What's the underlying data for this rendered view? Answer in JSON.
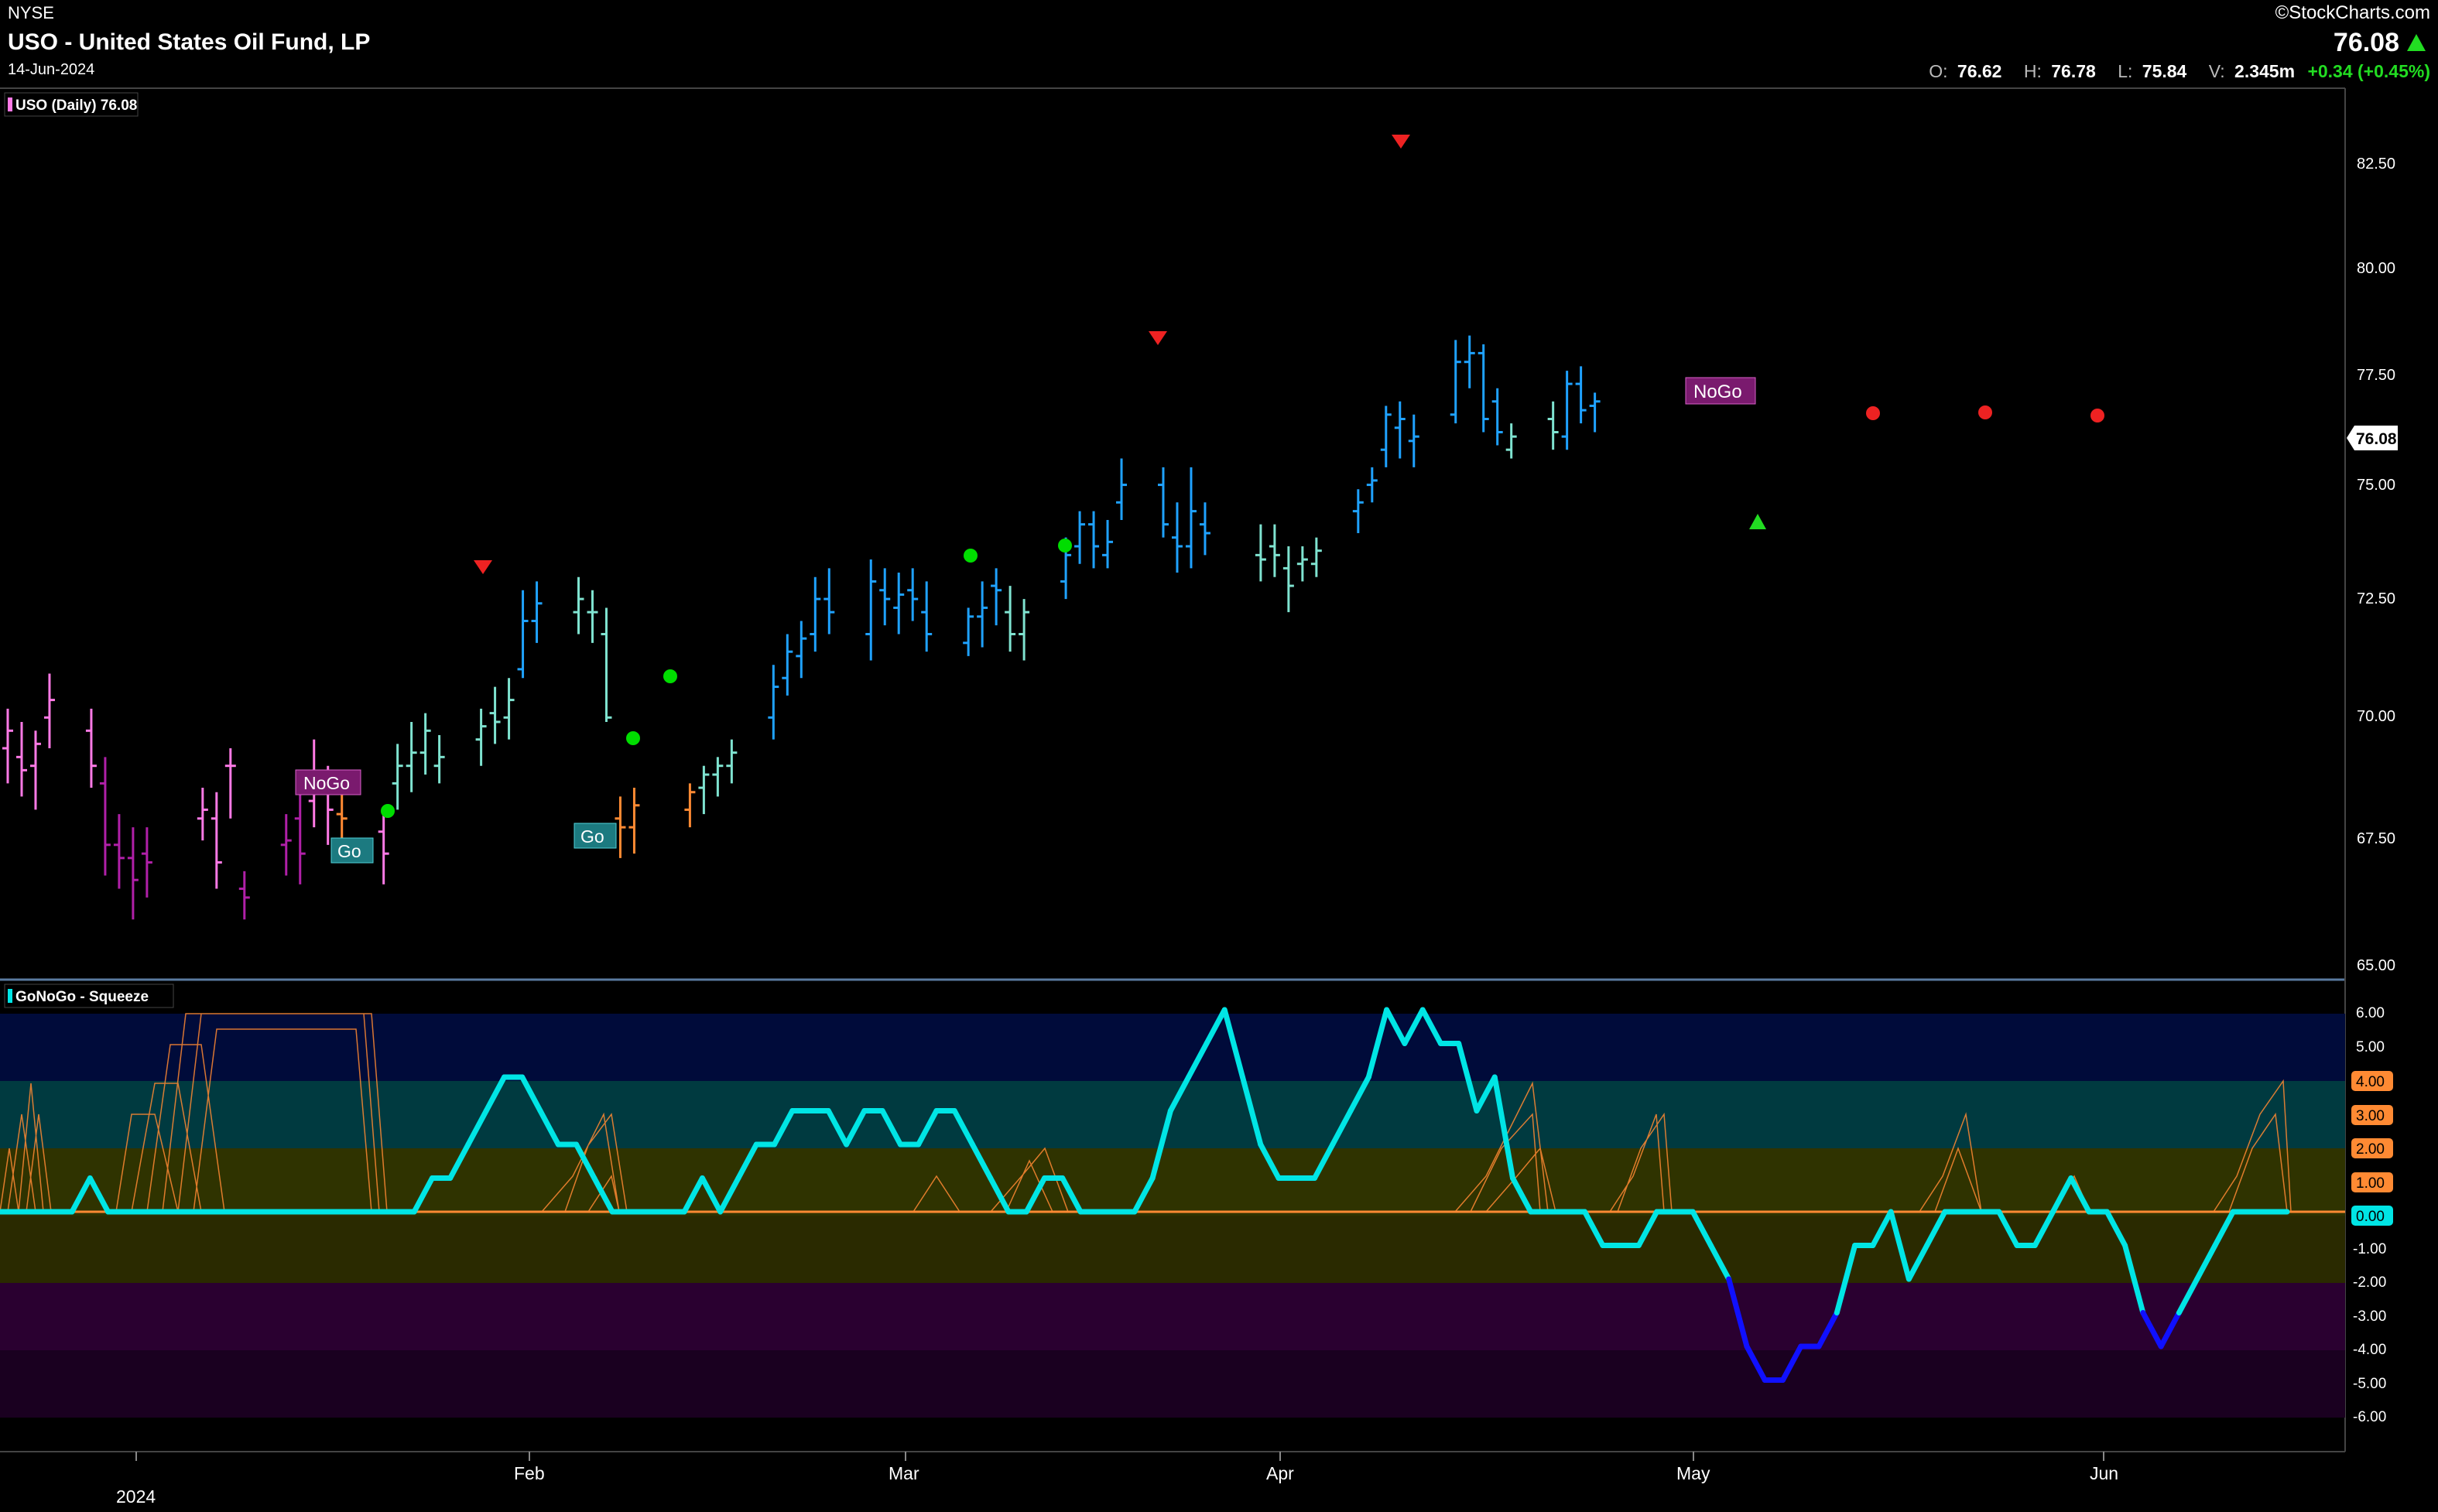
{
  "header": {
    "exchange": "NYSE",
    "title": "USO - United States Oil Fund, LP",
    "date": "14-Jun-2024",
    "brand": "©StockCharts.com",
    "last_price": "76.08",
    "ohlc": {
      "o_label": "O:",
      "o_value": "76.62",
      "h_label": "H:",
      "h_value": "76.78",
      "l_label": "L:",
      "l_value": "75.84",
      "v_label": "V:",
      "v_value": "2.345m",
      "change": "+0.34 (+0.45%)"
    }
  },
  "price_panel": {
    "legend": "USO (Daily) 76.08",
    "last_price_tag": "76.08",
    "y_ticks": [
      "82.50",
      "80.00",
      "77.50",
      "75.00",
      "72.50",
      "70.00",
      "67.50",
      "65.00"
    ],
    "labels": [
      {
        "text": "NoGo",
        "kind": "nogo"
      },
      {
        "text": "Go",
        "kind": "go"
      },
      {
        "text": "Go",
        "kind": "go"
      },
      {
        "text": "NoGo",
        "kind": "nogo"
      }
    ]
  },
  "oscillator_panel": {
    "legend": "GoNoGo - Squeeze",
    "y_ticks": [
      "6.00",
      "5.00",
      "4.00",
      "3.00",
      "2.00",
      "1.00",
      "0.00",
      "-1.00",
      "-2.00",
      "-3.00",
      "-4.00",
      "-5.00",
      "-6.00"
    ],
    "highlighted_ticks": [
      "4.00",
      "3.00",
      "2.00",
      "1.00",
      "0.00"
    ]
  },
  "x_axis": {
    "labels": [
      "2024",
      "Feb",
      "Mar",
      "Apr",
      "May",
      "Jun"
    ]
  },
  "colors": {
    "strong_go": "#1fa2ff",
    "weak_go": "#7fe3d0",
    "weak_nogo": "#ff7ae6",
    "strong_nogo": "#b020a8",
    "neutral": "#ff8a33",
    "oscillator": "#00e5e5",
    "oscillator_low": "#1010ff",
    "squeeze": "#ff8a33"
  },
  "chart_data": [
    {
      "type": "ohlc",
      "title": "USO (Daily) 76.08",
      "ylim": [
        64.5,
        83.8
      ],
      "x_range": [
        "2024-01-02",
        "2024-06-14"
      ],
      "last": {
        "open": 76.62,
        "high": 76.78,
        "low": 75.84,
        "close": 76.08,
        "volume": "2.345m",
        "change": 0.34,
        "change_pct": 0.45
      },
      "bars": [
        {
          "date": "2024-01-02",
          "open": 69.4,
          "high": 70.3,
          "low": 68.6,
          "close": 69.8,
          "color": "weak_nogo"
        },
        {
          "date": "2024-01-03",
          "open": 69.2,
          "high": 70.0,
          "low": 68.3,
          "close": 68.9,
          "color": "weak_nogo"
        },
        {
          "date": "2024-01-04",
          "open": 69.0,
          "high": 69.8,
          "low": 68.0,
          "close": 69.5,
          "color": "weak_nogo"
        },
        {
          "date": "2024-01-05",
          "open": 70.1,
          "high": 71.1,
          "low": 69.4,
          "close": 70.5,
          "color": "weak_nogo"
        },
        {
          "date": "2024-01-08",
          "open": 69.8,
          "high": 70.3,
          "low": 68.5,
          "close": 69.0,
          "color": "weak_nogo"
        },
        {
          "date": "2024-01-09",
          "open": 68.6,
          "high": 69.2,
          "low": 66.5,
          "close": 67.2,
          "color": "strong_nogo"
        },
        {
          "date": "2024-01-10",
          "open": 67.2,
          "high": 67.9,
          "low": 66.2,
          "close": 66.9,
          "color": "strong_nogo"
        },
        {
          "date": "2024-01-11",
          "open": 66.9,
          "high": 67.6,
          "low": 65.5,
          "close": 66.4,
          "color": "strong_nogo"
        },
        {
          "date": "2024-01-12",
          "open": 67.0,
          "high": 67.6,
          "low": 66.0,
          "close": 66.8,
          "color": "strong_nogo"
        },
        {
          "date": "2024-01-16",
          "open": 67.8,
          "high": 68.5,
          "low": 67.3,
          "close": 68.0,
          "color": "weak_nogo"
        },
        {
          "date": "2024-01-17",
          "open": 67.8,
          "high": 68.4,
          "low": 66.2,
          "close": 66.8,
          "color": "weak_nogo"
        },
        {
          "date": "2024-01-18",
          "open": 69.0,
          "high": 69.4,
          "low": 67.8,
          "close": 69.0,
          "color": "weak_nogo"
        },
        {
          "date": "2024-01-19",
          "open": 66.2,
          "high": 66.6,
          "low": 65.5,
          "close": 66.0,
          "color": "strong_nogo"
        },
        {
          "date": "2024-01-22",
          "open": 67.2,
          "high": 67.9,
          "low": 66.5,
          "close": 67.3,
          "color": "strong_nogo"
        },
        {
          "date": "2024-01-23",
          "open": 67.8,
          "high": 68.4,
          "low": 66.3,
          "close": 67.0,
          "color": "strong_nogo"
        },
        {
          "date": "2024-01-24",
          "open": 68.2,
          "high": 69.6,
          "low": 67.6,
          "close": 68.7,
          "color": "weak_nogo"
        },
        {
          "date": "2024-01-25",
          "open": 68.5,
          "high": 69.0,
          "low": 67.2,
          "close": 68.0,
          "color": "weak_nogo"
        },
        {
          "date": "2024-01-26",
          "open": 67.9,
          "high": 68.4,
          "low": 67.0,
          "close": 67.8,
          "color": "neutral"
        },
        {
          "date": "2024-01-29",
          "open": 67.5,
          "high": 68.0,
          "low": 66.3,
          "close": 67.0,
          "color": "weak_nogo"
        },
        {
          "date": "2024-01-30",
          "open": 68.6,
          "high": 69.5,
          "low": 68.0,
          "close": 69.0,
          "color": "weak_go"
        },
        {
          "date": "2024-01-31",
          "open": 69.0,
          "high": 70.0,
          "low": 68.4,
          "close": 69.3,
          "color": "weak_go"
        },
        {
          "date": "2024-02-01",
          "open": 69.3,
          "high": 70.2,
          "low": 68.8,
          "close": 69.8,
          "color": "weak_go"
        },
        {
          "date": "2024-02-02",
          "open": 69.0,
          "high": 69.7,
          "low": 68.6,
          "close": 69.2,
          "color": "weak_go"
        },
        {
          "date": "2024-02-05",
          "open": 69.6,
          "high": 70.3,
          "low": 69.0,
          "close": 69.9,
          "color": "weak_go"
        },
        {
          "date": "2024-02-06",
          "open": 70.2,
          "high": 70.8,
          "low": 69.5,
          "close": 70.0,
          "color": "weak_go"
        },
        {
          "date": "2024-02-07",
          "open": 70.1,
          "high": 71.0,
          "low": 69.6,
          "close": 70.5,
          "color": "weak_go"
        },
        {
          "date": "2024-02-08",
          "open": 71.2,
          "high": 73.0,
          "low": 71.0,
          "close": 72.3,
          "color": "strong_go"
        },
        {
          "date": "2024-02-09",
          "open": 72.3,
          "high": 73.2,
          "low": 71.8,
          "close": 72.7,
          "color": "strong_go"
        },
        {
          "date": "2024-02-12",
          "open": 72.5,
          "high": 73.3,
          "low": 72.0,
          "close": 72.8,
          "color": "weak_go"
        },
        {
          "date": "2024-02-13",
          "open": 72.5,
          "high": 73.0,
          "low": 71.8,
          "close": 72.5,
          "color": "weak_go"
        },
        {
          "date": "2024-02-14",
          "open": 72.0,
          "high": 72.6,
          "low": 70.0,
          "close": 70.1,
          "color": "weak_go"
        },
        {
          "date": "2024-02-15",
          "open": 67.8,
          "high": 68.3,
          "low": 66.9,
          "close": 67.6,
          "color": "neutral"
        },
        {
          "date": "2024-02-16",
          "open": 67.6,
          "high": 68.5,
          "low": 67.0,
          "close": 68.1,
          "color": "neutral"
        },
        {
          "date": "2024-02-20",
          "open": 68.0,
          "high": 68.6,
          "low": 67.6,
          "close": 68.4,
          "color": "neutral"
        },
        {
          "date": "2024-02-21",
          "open": 68.5,
          "high": 69.0,
          "low": 67.9,
          "close": 68.8,
          "color": "weak_go"
        },
        {
          "date": "2024-02-22",
          "open": 68.8,
          "high": 69.2,
          "low": 68.3,
          "close": 69.0,
          "color": "weak_go"
        },
        {
          "date": "2024-02-23",
          "open": 69.0,
          "high": 69.6,
          "low": 68.6,
          "close": 69.3,
          "color": "weak_go"
        },
        {
          "date": "2024-02-26",
          "open": 70.1,
          "high": 71.3,
          "low": 69.6,
          "close": 70.8,
          "color": "strong_go"
        },
        {
          "date": "2024-02-27",
          "open": 71.0,
          "high": 72.0,
          "low": 70.6,
          "close": 71.6,
          "color": "strong_go"
        },
        {
          "date": "2024-02-28",
          "open": 71.5,
          "high": 72.3,
          "low": 71.0,
          "close": 71.9,
          "color": "strong_go"
        },
        {
          "date": "2024-02-29",
          "open": 72.0,
          "high": 73.3,
          "low": 71.6,
          "close": 72.8,
          "color": "strong_go"
        },
        {
          "date": "2024-03-01",
          "open": 72.8,
          "high": 73.5,
          "low": 72.0,
          "close": 72.5,
          "color": "strong_go"
        },
        {
          "date": "2024-03-04",
          "open": 72.0,
          "high": 73.7,
          "low": 71.4,
          "close": 73.2,
          "color": "strong_go"
        },
        {
          "date": "2024-03-05",
          "open": 73.0,
          "high": 73.5,
          "low": 72.2,
          "close": 72.8,
          "color": "strong_go"
        },
        {
          "date": "2024-03-06",
          "open": 72.6,
          "high": 73.4,
          "low": 72.0,
          "close": 72.9,
          "color": "strong_go"
        },
        {
          "date": "2024-03-07",
          "open": 73.0,
          "high": 73.5,
          "low": 72.3,
          "close": 72.8,
          "color": "strong_go"
        },
        {
          "date": "2024-03-08",
          "open": 72.5,
          "high": 73.2,
          "low": 71.6,
          "close": 72.0,
          "color": "strong_go"
        },
        {
          "date": "2024-03-11",
          "open": 71.8,
          "high": 72.6,
          "low": 71.5,
          "close": 72.4,
          "color": "strong_go"
        },
        {
          "date": "2024-03-12",
          "open": 72.4,
          "high": 73.2,
          "low": 71.7,
          "close": 72.6,
          "color": "strong_go"
        },
        {
          "date": "2024-03-13",
          "open": 73.1,
          "high": 73.5,
          "low": 72.2,
          "close": 73.0,
          "color": "strong_go"
        },
        {
          "date": "2024-03-14",
          "open": 72.5,
          "high": 73.1,
          "low": 71.6,
          "close": 72.0,
          "color": "weak_go"
        },
        {
          "date": "2024-03-15",
          "open": 72.0,
          "high": 72.8,
          "low": 71.4,
          "close": 72.5,
          "color": "weak_go"
        },
        {
          "date": "2024-03-18",
          "open": 73.2,
          "high": 74.2,
          "low": 72.8,
          "close": 73.8,
          "color": "strong_go"
        },
        {
          "date": "2024-03-19",
          "open": 74.0,
          "high": 74.8,
          "low": 73.6,
          "close": 74.5,
          "color": "strong_go"
        },
        {
          "date": "2024-03-20",
          "open": 74.5,
          "high": 74.8,
          "low": 73.5,
          "close": 74.0,
          "color": "strong_go"
        },
        {
          "date": "2024-03-21",
          "open": 73.8,
          "high": 74.6,
          "low": 73.5,
          "close": 74.1,
          "color": "strong_go"
        },
        {
          "date": "2024-03-22",
          "open": 75.0,
          "high": 76.0,
          "low": 74.6,
          "close": 75.4,
          "color": "strong_go"
        },
        {
          "date": "2024-03-25",
          "open": 75.4,
          "high": 75.8,
          "low": 74.2,
          "close": 74.5,
          "color": "strong_go"
        },
        {
          "date": "2024-03-26",
          "open": 74.2,
          "high": 75.0,
          "low": 73.4,
          "close": 74.0,
          "color": "strong_go"
        },
        {
          "date": "2024-03-27",
          "open": 74.0,
          "high": 75.8,
          "low": 73.5,
          "close": 74.8,
          "color": "strong_go"
        },
        {
          "date": "2024-03-28",
          "open": 74.5,
          "high": 75.0,
          "low": 73.8,
          "close": 74.3,
          "color": "strong_go"
        },
        {
          "date": "2024-04-01",
          "open": 73.8,
          "high": 74.5,
          "low": 73.2,
          "close": 73.7,
          "color": "weak_go"
        },
        {
          "date": "2024-04-02",
          "open": 74.0,
          "high": 74.5,
          "low": 73.3,
          "close": 73.8,
          "color": "weak_go"
        },
        {
          "date": "2024-04-03",
          "open": 73.5,
          "high": 74.0,
          "low": 72.5,
          "close": 73.1,
          "color": "weak_go"
        },
        {
          "date": "2024-04-04",
          "open": 73.6,
          "high": 74.0,
          "low": 73.2,
          "close": 73.7,
          "color": "weak_go"
        },
        {
          "date": "2024-04-05",
          "open": 73.6,
          "high": 74.2,
          "low": 73.3,
          "close": 73.9,
          "color": "weak_go"
        },
        {
          "date": "2024-04-08",
          "open": 74.8,
          "high": 75.3,
          "low": 74.3,
          "close": 75.0,
          "color": "strong_go"
        },
        {
          "date": "2024-04-09",
          "open": 75.4,
          "high": 75.8,
          "low": 75.0,
          "close": 75.5,
          "color": "strong_go"
        },
        {
          "date": "2024-04-10",
          "open": 76.2,
          "high": 77.2,
          "low": 75.8,
          "close": 77.0,
          "color": "strong_go"
        },
        {
          "date": "2024-04-11",
          "open": 76.7,
          "high": 77.3,
          "low": 76.0,
          "close": 76.9,
          "color": "strong_go"
        },
        {
          "date": "2024-04-12",
          "open": 76.4,
          "high": 77.0,
          "low": 75.8,
          "close": 76.5,
          "color": "strong_go"
        },
        {
          "date": "2024-04-15",
          "open": 77.0,
          "high": 78.7,
          "low": 76.8,
          "close": 78.2,
          "color": "strong_go"
        },
        {
          "date": "2024-04-16",
          "open": 78.2,
          "high": 78.8,
          "low": 77.6,
          "close": 78.4,
          "color": "strong_go"
        },
        {
          "date": "2024-04-17",
          "open": 78.4,
          "high": 78.6,
          "low": 76.6,
          "close": 76.9,
          "color": "strong_go"
        },
        {
          "date": "2024-04-18",
          "open": 77.3,
          "high": 77.6,
          "low": 76.3,
          "close": 76.6,
          "color": "strong_go"
        },
        {
          "date": "2024-04-19",
          "open": 76.2,
          "high": 76.8,
          "low": 76.0,
          "close": 76.5,
          "color": "weak_go"
        },
        {
          "date": "2024-04-22",
          "open": 76.9,
          "high": 77.3,
          "low": 76.2,
          "close": 76.6,
          "color": "weak_go"
        },
        {
          "date": "2024-04-23",
          "open": 76.5,
          "high": 78.0,
          "low": 76.2,
          "close": 77.7,
          "color": "strong_go"
        },
        {
          "date": "2024-04-24",
          "open": 77.7,
          "high": 78.1,
          "low": 76.8,
          "close": 77.1,
          "color": "strong_go"
        },
        {
          "date": "2024-04-25",
          "open": 77.2,
          "high": 77.5,
          "low": 76.6,
          "close": 77.3,
          "color": "strong_go"
        }
      ]
    },
    {
      "type": "line",
      "title": "GoNoGo - Squeeze",
      "ylim": [
        -6.8,
        6.8
      ],
      "note": "oscillator values on the same daily x axis",
      "series": [
        {
          "values": [
            0,
            0,
            0,
            0,
            0,
            1,
            0,
            0,
            0,
            0,
            0,
            0,
            0,
            0,
            0,
            0,
            0,
            0,
            0,
            0,
            0,
            0,
            0,
            0,
            1,
            1,
            2,
            3,
            4,
            4,
            3,
            2,
            2,
            1,
            0,
            0,
            0,
            0,
            0,
            1,
            0,
            1,
            2,
            2,
            3,
            3,
            3,
            2,
            3,
            3,
            2,
            2,
            3,
            3,
            2,
            1,
            0,
            0,
            1,
            1,
            0,
            0,
            0,
            0,
            1,
            3,
            4,
            5,
            6,
            4,
            2,
            1,
            1,
            1,
            2,
            3,
            4,
            6,
            5,
            6,
            5,
            5,
            3,
            4,
            1,
            0,
            0,
            0,
            0,
            -1,
            -1,
            -1,
            0,
            0,
            0,
            -1,
            -2,
            -4,
            -5,
            -5,
            -4,
            -4,
            -3,
            -1,
            -1,
            0,
            -2,
            -1,
            0,
            0,
            0,
            0,
            -1,
            -1,
            0,
            1,
            0,
            0,
            -1,
            -3,
            -4,
            -3,
            -2,
            -1,
            0,
            0,
            0,
            0
          ]
        }
      ]
    }
  ]
}
